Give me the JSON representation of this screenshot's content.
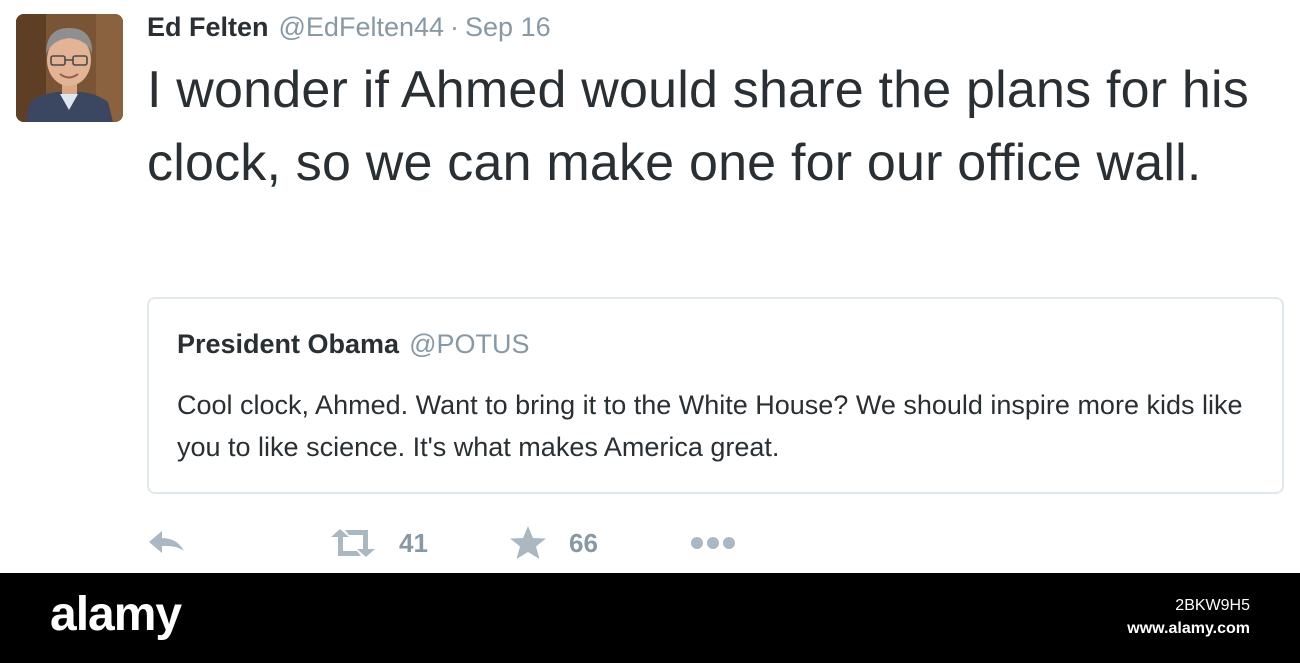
{
  "tweet": {
    "author_name": "Ed Felten",
    "author_handle": "@EdFelten44",
    "separator": "·",
    "date": "Sep 16",
    "text": "I wonder if Ahmed would share the plans for his clock, so we can make one for our office wall."
  },
  "quoted_tweet": {
    "author_name": "President Obama",
    "author_handle": "@POTUS",
    "text": "Cool clock, Ahmed. Want to bring it to the White House? We should inspire more kids like you to like science. It's what makes America great."
  },
  "actions": {
    "reply_icon": "reply-icon",
    "retweet_icon": "retweet-icon",
    "retweet_count": "41",
    "favorite_icon": "star-icon",
    "favorite_count": "66",
    "more_icon": "more-dots-icon"
  },
  "watermark": {
    "logo": "alamy",
    "image_id": "2BKW9H5",
    "url": "www.alamy.com"
  },
  "colors": {
    "text_primary": "#292f33",
    "text_secondary": "#8899a6",
    "icon_gray": "#aab8c2",
    "card_border": "#e1e8ed",
    "footer_bg": "#000000"
  }
}
